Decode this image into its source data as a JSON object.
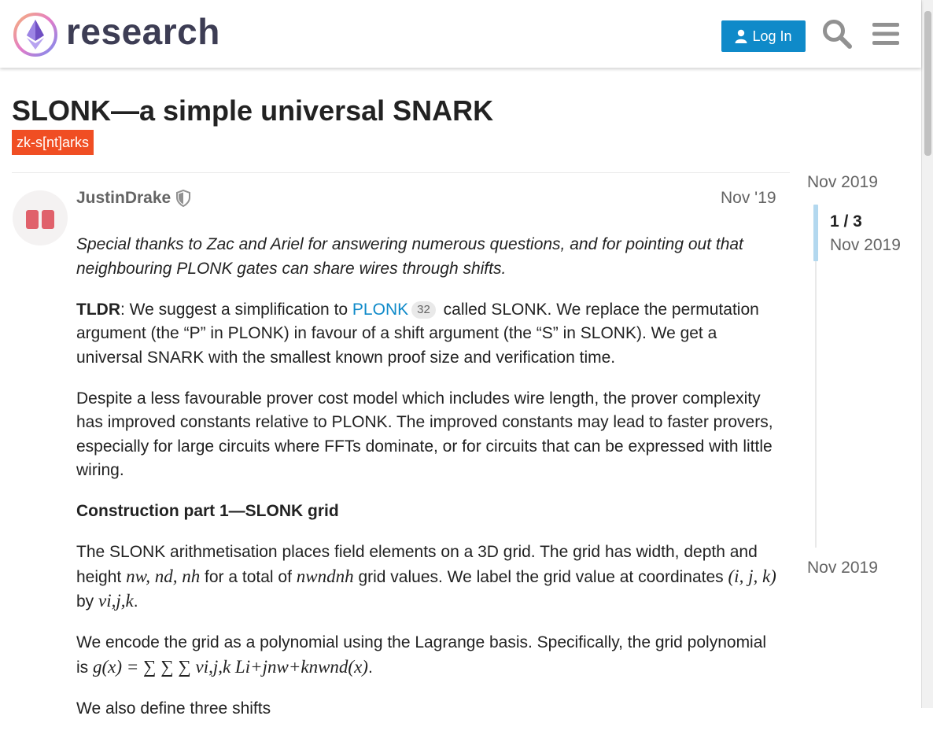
{
  "header": {
    "brand": "research",
    "login_label": "Log In",
    "icons": [
      "search-icon",
      "menu-icon"
    ],
    "colors": {
      "login_bg": "#0f8ac9",
      "brand_text": "#3d3d54"
    }
  },
  "topic": {
    "title": "SLONK—a simple universal SNARK",
    "category": "zk-s[nt]arks",
    "category_color": "#f04e23"
  },
  "post": {
    "author": "JustinDrake",
    "date": "Nov '19",
    "intro_italic": "Special thanks to Zac and Ariel for answering numerous questions, and for pointing out that neighbouring PLONK gates can share wires through shifts.",
    "tldr_label": "TLDR",
    "tldr_a": ": We suggest a simplification to ",
    "plonk_link": "PLONK",
    "plonk_clicks": "32",
    "tldr_b": " called SLONK. We replace the permutation argument (the “P” in PLONK) in favour of a shift argument (the “S” in SLONK). We get a universal SNARK with the smallest known proof size and verification time.",
    "para2": "Despite a less favourable prover cost model which includes wire length, the prover complexity has improved constants relative to PLONK. The improved constants may lead to faster provers, especially for large circuits where FFTs dominate, or for circuits that can be expressed with little wiring.",
    "heading1": "Construction part 1—SLONK grid",
    "para3_a": "The SLONK arithmetisation places field elements on a 3D grid. The grid has width, depth and height ",
    "math_dims": "nw, nd, nh",
    "para3_b": " for a total of ",
    "math_total": "nwndnh",
    "para3_c": " grid values. We label the grid value at coordinates ",
    "math_coords": "(i, j, k)",
    "para3_d": " by ",
    "math_v": "vi,j,k",
    "para3_e": ".",
    "para4_a": "We encode the grid as a polynomial using the Lagrange basis. Specifically, the grid polynomial is ",
    "math_poly": "g(x) = ∑ ∑ ∑ vi,j,k Li+jnw+knwnd(x)",
    "para4_b": ".",
    "para5_a": "We also define three shifts"
  },
  "timeline": {
    "start": "Nov 2019",
    "position": "1 / 3",
    "current_date": "Nov 2019",
    "end": "Nov 2019"
  }
}
